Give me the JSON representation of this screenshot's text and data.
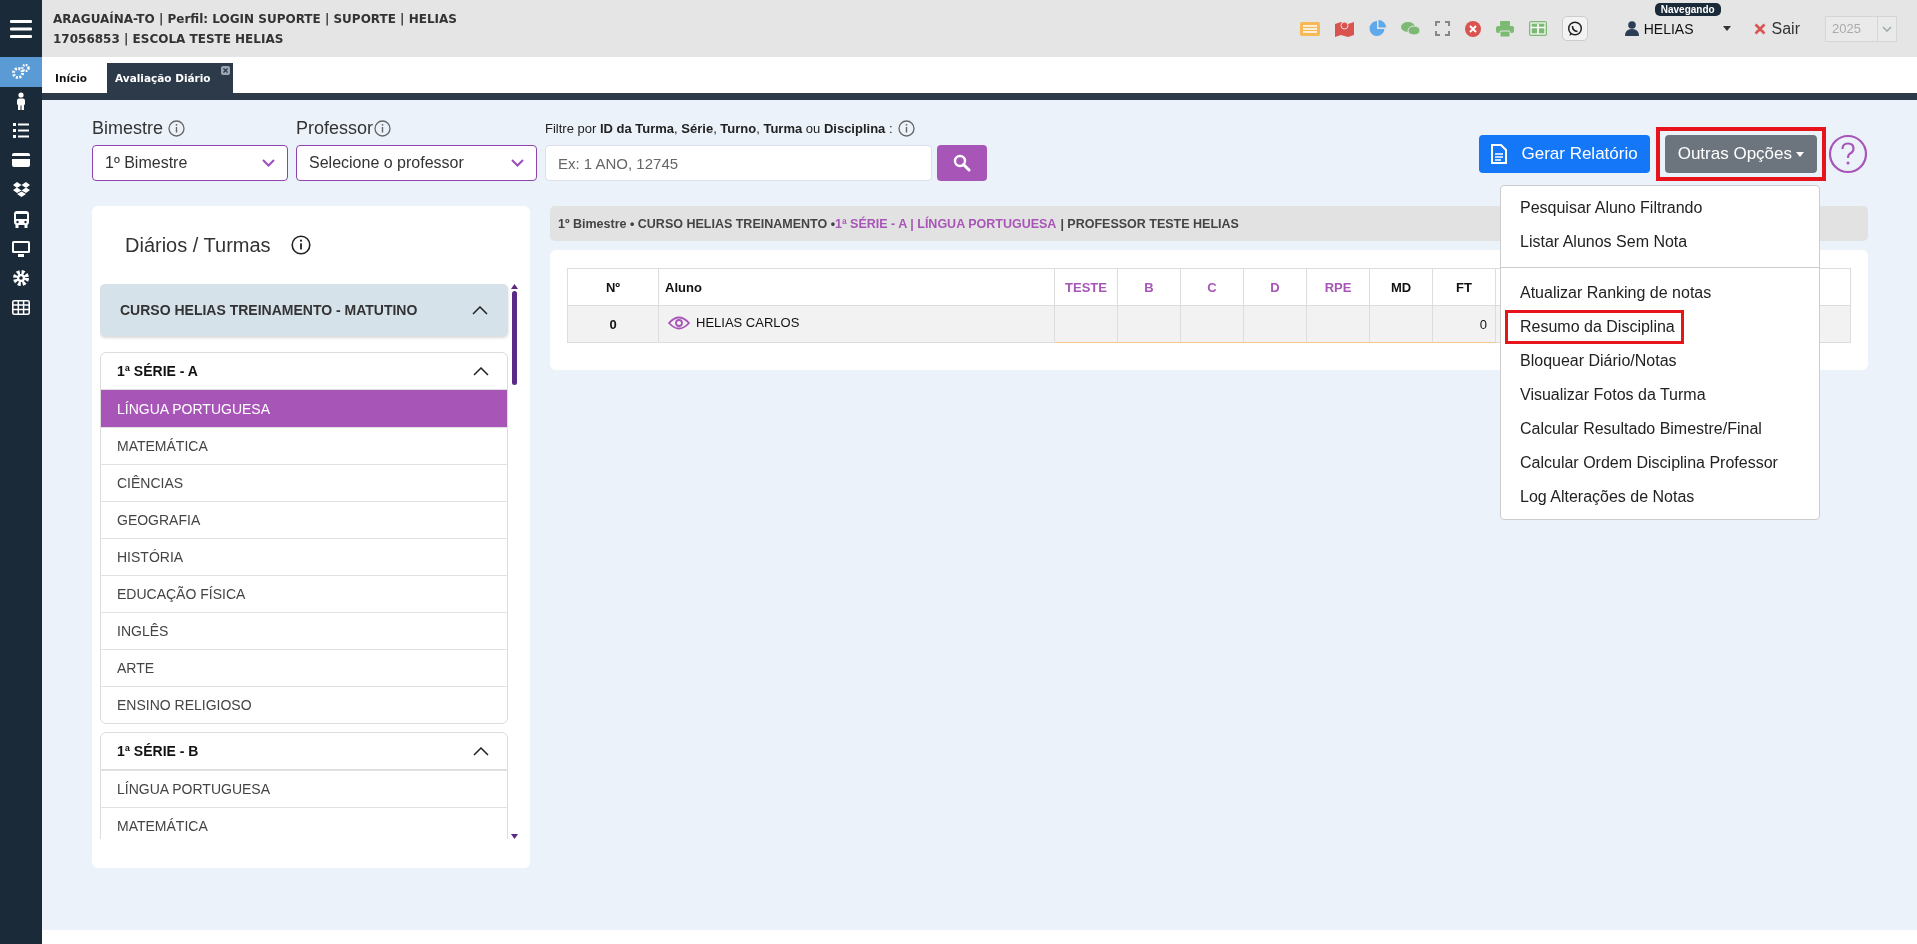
{
  "header": {
    "lines": [
      "ARAGUAÍNA-TO | Perfil: LOGIN SUPORTE | SUPORTE | HELIAS",
      "17056853 | ESCOLA TESTE HELIAS"
    ],
    "user": "HELIAS",
    "user_tooltip": "Navegando",
    "logout": "Sair",
    "year": {
      "value": "2025",
      "disabled": true
    }
  },
  "rail": {
    "items": [
      {
        "kind": "gears",
        "selected": true
      },
      {
        "kind": "person",
        "selected": false
      },
      {
        "kind": "list",
        "selected": false
      },
      {
        "kind": "card",
        "selected": false
      },
      {
        "kind": "boxes",
        "selected": false
      },
      {
        "kind": "bus",
        "selected": false
      },
      {
        "kind": "monitor",
        "selected": false
      },
      {
        "kind": "gear",
        "selected": false
      },
      {
        "kind": "table",
        "selected": false
      }
    ]
  },
  "tabs": [
    {
      "label": "Início",
      "selected": false,
      "closable": false
    },
    {
      "label": "Avaliação Diário",
      "selected": true,
      "closable": true
    }
  ],
  "filters": {
    "bimestre": {
      "label": "Bimestre",
      "value": "1º Bimestre"
    },
    "professor": {
      "label": "Professor",
      "value": "Selecione o professor"
    },
    "search": {
      "label": "Filtre por **ID da Turma**, **Série**, **Turno**, **Turma** ou **Disciplina** :",
      "placeholder": "Ex: 1 ANO, 12745"
    }
  },
  "actions": {
    "report": "Gerar Relatório",
    "options": {
      "label": "Outras Opções",
      "highlighted": true
    }
  },
  "menu": {
    "groups": [
      [
        {
          "label": "Pesquisar Aluno Filtrando",
          "highlighted": false
        },
        {
          "label": "Listar Alunos Sem Nota",
          "highlighted": false
        }
      ],
      [
        {
          "label": "Atualizar Ranking de notas",
          "highlighted": false
        },
        {
          "label": "Resumo da Disciplina",
          "highlighted": true
        },
        {
          "label": "Bloquear Diário/Notas",
          "highlighted": false
        },
        {
          "label": "Visualizar Fotos da Turma",
          "highlighted": false
        },
        {
          "label": "Calcular Resultado Bimestre/Final",
          "highlighted": false
        },
        {
          "label": "Calcular Ordem Disciplina Professor",
          "highlighted": false
        },
        {
          "label": "Log Alterações de Notas",
          "highlighted": false
        }
      ]
    ]
  },
  "sidebar": {
    "title": "Diários / Turmas",
    "course": {
      "label": "CURSO HELIAS TREINAMENTO - MATUTINO",
      "expanded": true
    },
    "classes": [
      {
        "label": "1ª SÉRIE - A",
        "expanded": true,
        "subjects": [
          {
            "label": "LÍNGUA PORTUGUESA",
            "selected": true
          },
          {
            "label": "MATEMÁTICA",
            "selected": false
          },
          {
            "label": "CIÊNCIAS",
            "selected": false
          },
          {
            "label": "GEOGRAFIA",
            "selected": false
          },
          {
            "label": "HISTÓRIA",
            "selected": false
          },
          {
            "label": "EDUCAÇÃO FÍSICA",
            "selected": false
          },
          {
            "label": "INGLÊS",
            "selected": false
          },
          {
            "label": "ARTE",
            "selected": false
          },
          {
            "label": "ENSINO RELIGIOSO",
            "selected": false
          }
        ]
      },
      {
        "label": "1ª SÉRIE - B",
        "expanded": true,
        "subjects": [
          {
            "label": "LÍNGUA PORTUGUESA",
            "selected": false
          },
          {
            "label": "MATEMÁTICA",
            "selected": false
          }
        ]
      }
    ]
  },
  "breadcrumb": {
    "bimestre": "1º Bimestre •",
    "course": "CURSO HELIAS TREINAMENTO •",
    "class_subject": "1ª SÉRIE - A | LÍNGUA PORTUGUESA",
    "professor": "| PROFESSOR TESTE HELIAS"
  },
  "table": {
    "columns": [
      {
        "label": "Nº",
        "kind": "number"
      },
      {
        "label": "Aluno",
        "kind": "name"
      },
      {
        "label": "TESTE",
        "kind": "grade"
      },
      {
        "label": "B",
        "kind": "grade"
      },
      {
        "label": "C",
        "kind": "grade"
      },
      {
        "label": "D",
        "kind": "grade"
      },
      {
        "label": "RPE",
        "kind": "grade"
      },
      {
        "label": "MD",
        "kind": "average"
      },
      {
        "label": "FT",
        "kind": "absences"
      }
    ],
    "rows": [
      {
        "number": "0",
        "student": "HELIAS CARLOS",
        "absences": "0"
      }
    ]
  }
}
